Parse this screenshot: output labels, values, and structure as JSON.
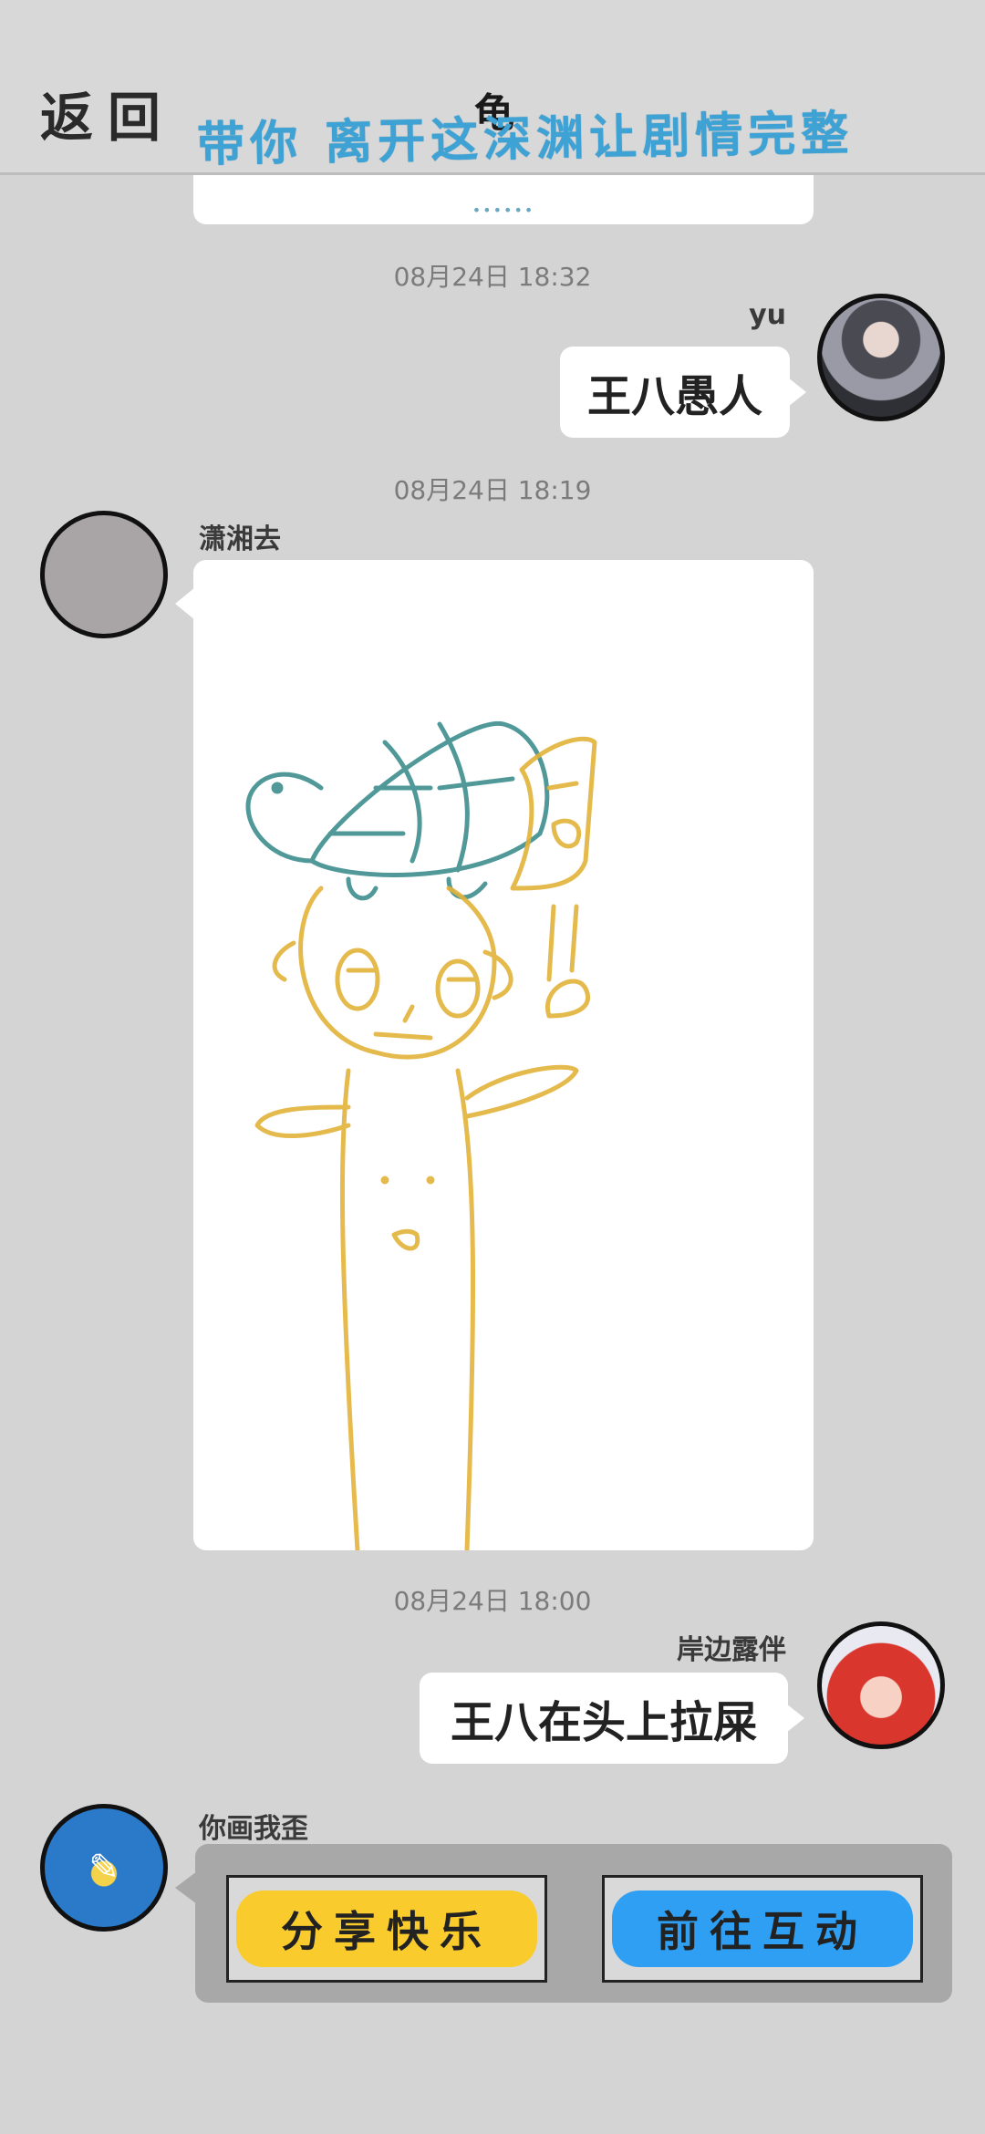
{
  "header": {
    "back_label": "返回",
    "title": "龟",
    "banner_text": "带你 离开这深渊让剧情完整"
  },
  "top_card": {
    "dots": "••••••"
  },
  "messages": [
    {
      "time": "08月24日  18:32",
      "sender": "yu",
      "text": "王八愚人"
    },
    {
      "time": "08月24日  18:19",
      "sender": "潇湘去"
    },
    {
      "time": "08月24日  18:00",
      "sender": "岸边露伴",
      "text": "王八在头上拉屎"
    },
    {
      "sender": "你画我歪"
    }
  ],
  "actions": {
    "share_label": "分享快乐",
    "go_label": "前往互动"
  },
  "colors": {
    "background": "#d4d4d4",
    "banner": "#3ea2d4",
    "share_button": "#f9cb2c",
    "go_button": "#2e9ff3",
    "turtle_stroke": "#3f8f8f",
    "figure_stroke": "#e3b33a"
  }
}
